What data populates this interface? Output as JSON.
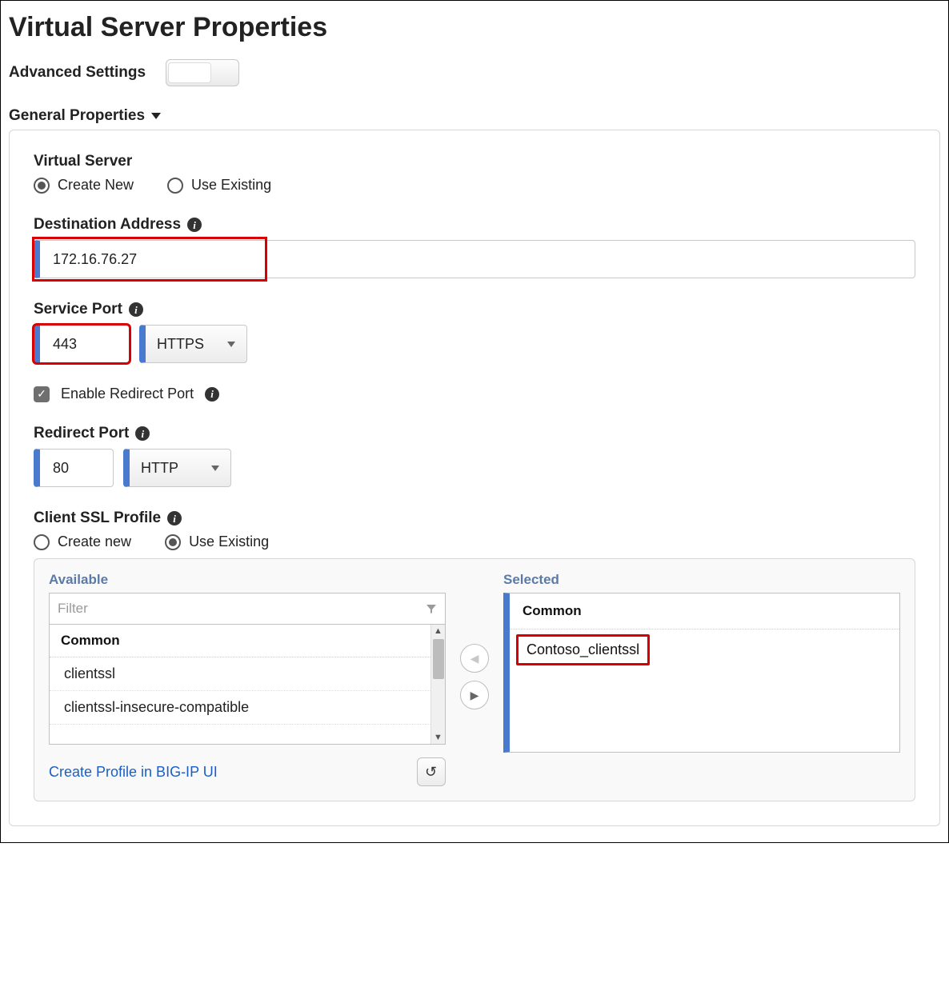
{
  "title": "Virtual Server Properties",
  "advanced": {
    "label": "Advanced Settings",
    "on": false
  },
  "section": {
    "label": "General Properties"
  },
  "virtual_server": {
    "label": "Virtual Server",
    "create_label": "Create New",
    "existing_label": "Use Existing",
    "selected": "create"
  },
  "dest_addr": {
    "label": "Destination Address",
    "value": "172.16.76.27"
  },
  "service_port": {
    "label": "Service Port",
    "value": "443",
    "protocol": "HTTPS"
  },
  "enable_redirect": {
    "label": "Enable Redirect Port",
    "checked": true
  },
  "redirect_port": {
    "label": "Redirect Port",
    "value": "80",
    "protocol": "HTTP"
  },
  "ssl_profile": {
    "label": "Client SSL Profile",
    "create_label": "Create new",
    "existing_label": "Use Existing",
    "selected": "existing",
    "available_label": "Available",
    "selected_label": "Selected",
    "filter_placeholder": "Filter",
    "group_label": "Common",
    "available_items": [
      "clientssl",
      "clientssl-insecure-compatible"
    ],
    "selected_items": [
      "Contoso_clientssl"
    ],
    "create_link": "Create Profile in BIG-IP UI"
  }
}
